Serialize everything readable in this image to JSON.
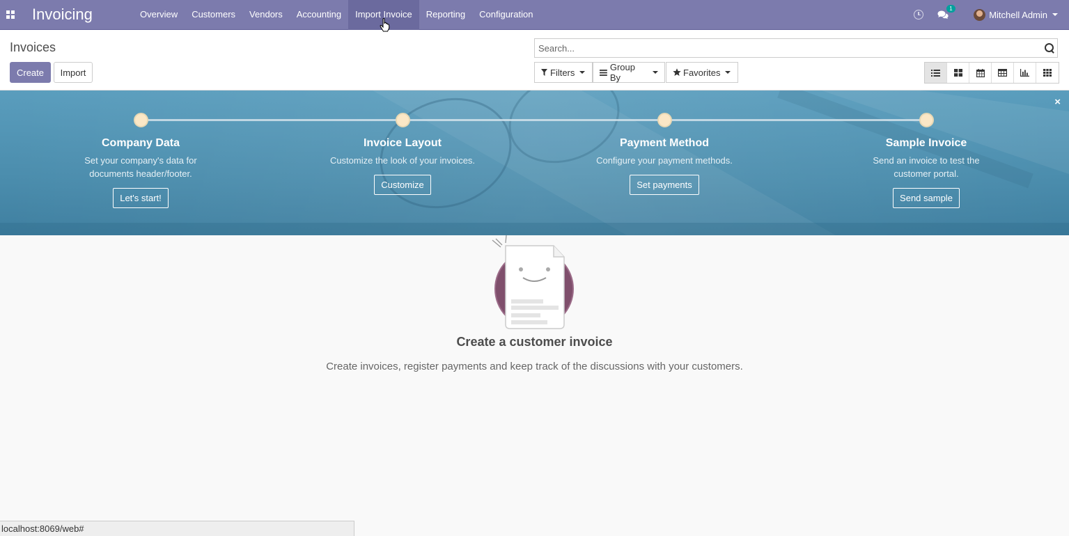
{
  "navbar": {
    "brand": "Invoicing",
    "menu": [
      {
        "label": "Overview"
      },
      {
        "label": "Customers"
      },
      {
        "label": "Vendors"
      },
      {
        "label": "Accounting"
      },
      {
        "label": "Import Invoice"
      },
      {
        "label": "Reporting"
      },
      {
        "label": "Configuration"
      }
    ],
    "active_menu": "Import Invoice",
    "chat_badge": "1",
    "user_name": "Mitchell Admin",
    "bg_color": "#7c7bad"
  },
  "control_panel": {
    "breadcrumb": "Invoices",
    "create_label": "Create",
    "import_label": "Import",
    "search_placeholder": "Search...",
    "filters_label": "Filters",
    "group_by_label": "Group By",
    "favorites_label": "Favorites",
    "views": [
      "list-view-icon",
      "kanban-view-icon",
      "calendar-view-icon",
      "pivot-view-icon",
      "graph-view-icon",
      "grid-view-icon"
    ],
    "active_view": "list-view-icon"
  },
  "banner": {
    "steps": [
      {
        "title": "Company Data",
        "desc": "Set your company's data for documents header/footer.",
        "button": "Let's start!"
      },
      {
        "title": "Invoice Layout",
        "desc": "Customize the look of your invoices.",
        "button": "Customize"
      },
      {
        "title": "Payment Method",
        "desc": "Configure your payment methods.",
        "button": "Set payments"
      },
      {
        "title": "Sample Invoice",
        "desc": "Send an invoice to test the customer portal.",
        "button": "Send sample"
      }
    ],
    "close": "×"
  },
  "empty_state": {
    "title": "Create a customer invoice",
    "text": "Create invoices, register payments and keep track of the discussions with your customers."
  },
  "status_bar": {
    "url": "localhost:8069/web#"
  }
}
